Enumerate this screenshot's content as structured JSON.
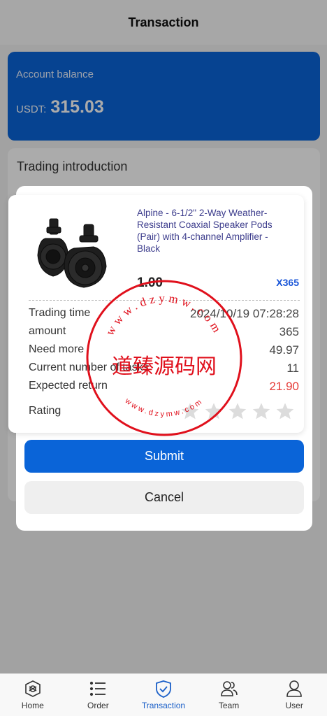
{
  "header": {
    "title": "Transaction"
  },
  "balance": {
    "label": "Account balance",
    "currency": "USDT:",
    "value": "315.03"
  },
  "intro": {
    "title": "Trading introduction"
  },
  "modal": {
    "product": {
      "title": "Alpine - 6-1/2\" 2-Way Weather-Resistant Coaxial Speaker Pods (Pair) with 4-channel Amplifier - Black",
      "price": "1.00",
      "multiplier": "X365"
    },
    "rows": [
      {
        "label": "Trading time",
        "value": "2024/10/19 07:28:28"
      },
      {
        "label": "amount",
        "value": "365"
      },
      {
        "label": "Need more",
        "value": "49.97"
      },
      {
        "label": "Current number of tasks",
        "value": "11"
      },
      {
        "label": "Expected return",
        "value": "21.90",
        "color": "#e53935"
      }
    ],
    "rating": {
      "label": "Rating",
      "stars": 5,
      "filled": 0
    },
    "submit_label": "Submit",
    "cancel_label": "Cancel"
  },
  "stamp": {
    "center_text": "道臻源码网",
    "ring_text": "www.dzymw.com",
    "color": "#e0101c"
  },
  "tabs": [
    {
      "label": "Home",
      "icon": "home-icon"
    },
    {
      "label": "Order",
      "icon": "list-icon"
    },
    {
      "label": "Transaction",
      "icon": "transaction-shield-icon",
      "active": true
    },
    {
      "label": "Team",
      "icon": "team-icon"
    },
    {
      "label": "User",
      "icon": "user-icon"
    }
  ],
  "colors": {
    "primary": "#0a64d8",
    "accent_text": "#1a5fc8",
    "danger": "#e53935"
  }
}
